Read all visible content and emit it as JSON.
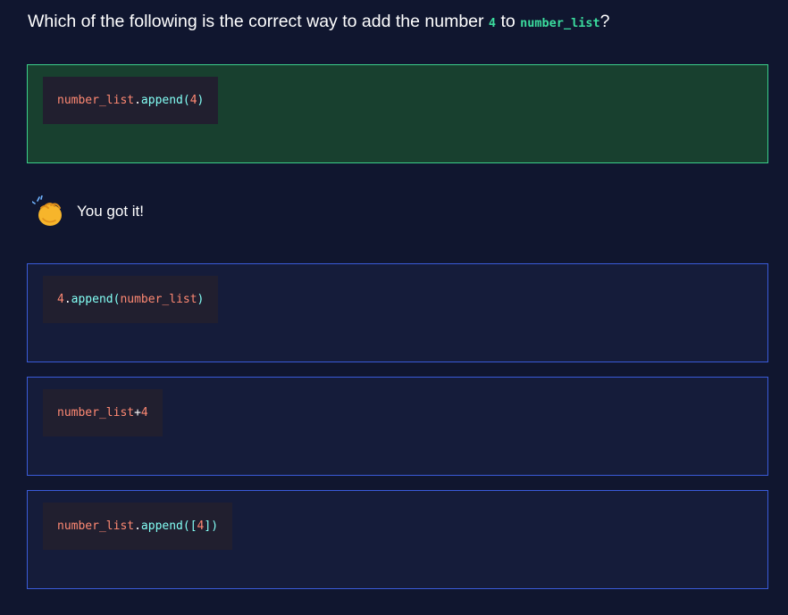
{
  "question": {
    "prefix": "Which of the following is the correct way to add the number ",
    "num": "4",
    "middle": " to ",
    "var": "number_list",
    "suffix": "?"
  },
  "options": [
    {
      "state": "correct",
      "code": {
        "t1": "number_list",
        "t2": ".",
        "t3": "append",
        "t4": "(",
        "t5": "4",
        "t6": ")"
      }
    },
    {
      "state": "default",
      "code": {
        "t1": "4",
        "t2": ".",
        "t3": "append",
        "t4": "(",
        "t5": "number_list",
        "t6": ")"
      }
    },
    {
      "state": "default",
      "code": {
        "t1": "number_list",
        "t2": " + ",
        "t3": "4"
      }
    },
    {
      "state": "default",
      "code": {
        "t1": "number_list",
        "t2": ".",
        "t3": "append",
        "t4": "([",
        "t5": "4",
        "t6": "])"
      }
    }
  ],
  "feedback": {
    "icon": "clapping-hands-icon",
    "text": "You got it!"
  },
  "colors": {
    "background": "#10162f",
    "correct_bg": "#18402f",
    "correct_border": "#3bcf8a",
    "option_border": "#3a5bd9",
    "code_var": "#ff8973",
    "code_fn": "#83fff5",
    "inline_code": "#3bdc9e"
  }
}
